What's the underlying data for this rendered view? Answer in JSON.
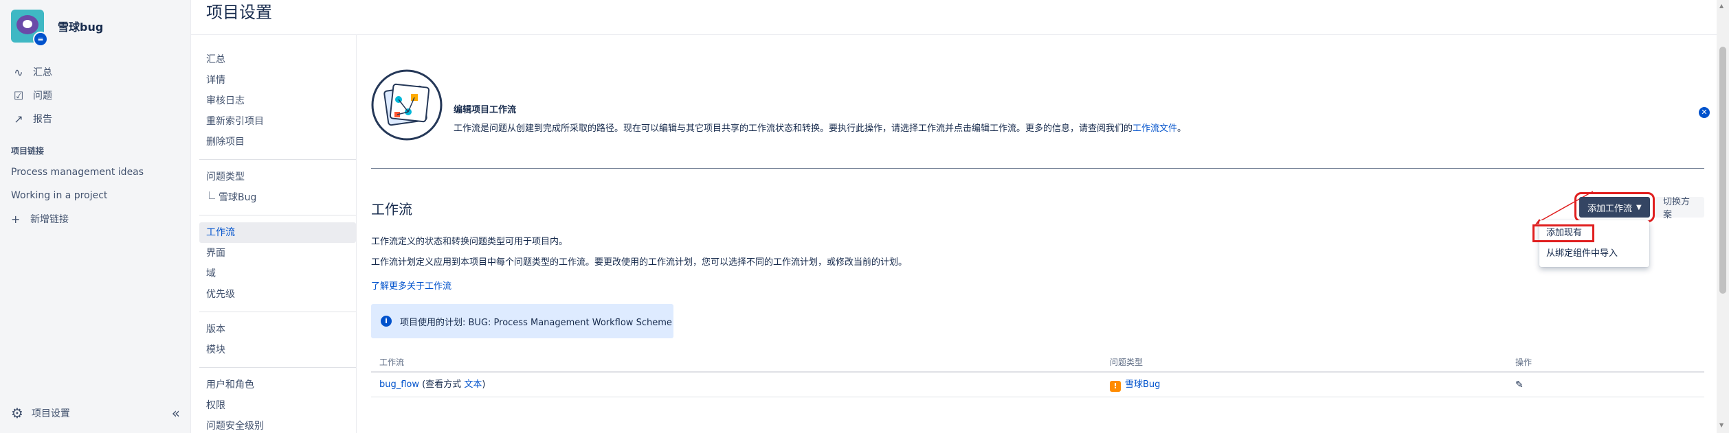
{
  "project": {
    "name": "雪球bug",
    "badge_icon": "document-icon"
  },
  "sidebar": {
    "items": [
      {
        "icon": "activity-icon",
        "glyph": "∿",
        "label": "汇总"
      },
      {
        "icon": "issues-icon",
        "glyph": "☑",
        "label": "问题"
      },
      {
        "icon": "reports-icon",
        "glyph": "↗",
        "label": "报告"
      }
    ],
    "section_title": "项目链接",
    "links": [
      "Process management ideas",
      "Working in a project"
    ],
    "add_link_label": "新增链接",
    "footer_label": "项目设置",
    "collapse_glyph": "«"
  },
  "page_title": "项目设置",
  "settings_nav": {
    "group1": [
      "汇总",
      "详情",
      "审核日志",
      "重新索引项目",
      "删除项目"
    ],
    "issue_types_title": "问题类型",
    "issue_types_sub": "雪球Bug",
    "group2": [
      "工作流",
      "界面",
      "域",
      "优先级"
    ],
    "group3": [
      "版本",
      "模块"
    ],
    "group4": [
      "用户和角色",
      "权限",
      "问题安全级别"
    ],
    "active": "工作流"
  },
  "intro": {
    "title": "编辑项目工作流",
    "text": "工作流是问题从创建到完成所采取的路径。现在可以编辑与其它项目共享的工作流状态和转换。要执行此操作，请选择工作流并点击编辑工作流。更多的信息，请查阅我们的",
    "link": "工作流文件",
    "text_end": "。"
  },
  "workflow": {
    "heading": "工作流",
    "add_button": "添加工作流",
    "switch_button": "切换方案",
    "dropdown": [
      "添加现有",
      "从绑定组件中导入"
    ],
    "desc1": "工作流定义的状态和转换问题类型可用于项目内。",
    "desc2": "工作流计划定义应用到本项目中每个问题类型的工作流。要更改使用的工作流计划，您可以选择不同的工作流计划，或修改当前的计划。",
    "learn_more": "了解更多关于工作流",
    "scheme_info": "项目使用的计划: BUG: Process Management Workflow Scheme",
    "table": {
      "headers": [
        "工作流",
        "问题类型",
        "操作"
      ],
      "rows": [
        {
          "workflow": "bug_flow",
          "view_prefix": "(查看方式",
          "view_link": "文本",
          "view_suffix": ")",
          "issue_type": "雪球Bug"
        }
      ]
    }
  },
  "colors": {
    "accent": "#0052cc",
    "button_dark": "#344563",
    "highlight_red": "#e01e1e",
    "info_bg": "#deebff",
    "bug_orange": "#ff8b00"
  }
}
